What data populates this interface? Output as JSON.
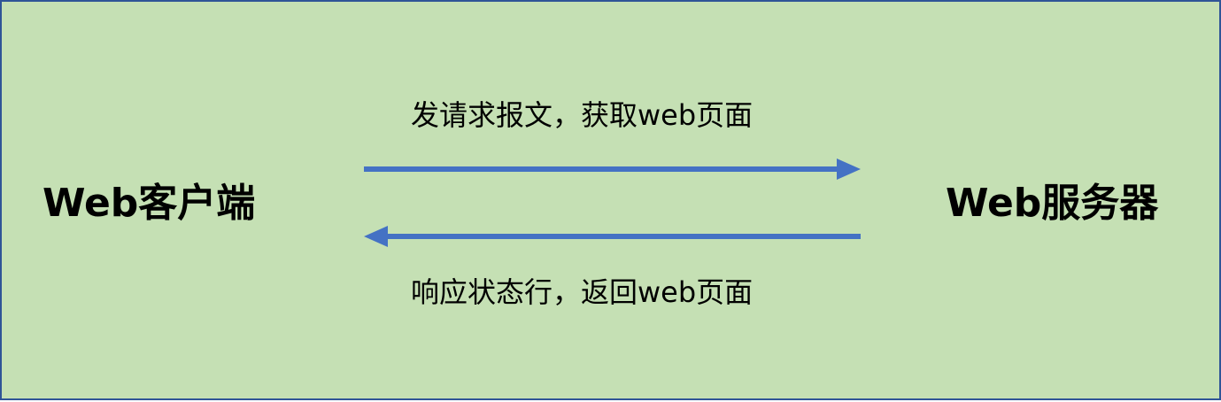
{
  "diagram": {
    "client": "Web客户端",
    "server": "Web服务器",
    "request_label": "发请求报文，获取web页面",
    "response_label": "响应状态行，返回web页面"
  },
  "colors": {
    "background": "#c5e0b4",
    "border": "#2f5597",
    "arrow": "#4472c4",
    "text": "#000000"
  }
}
